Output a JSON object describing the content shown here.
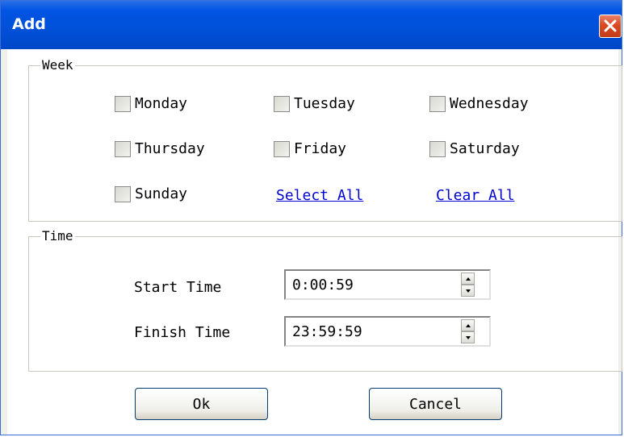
{
  "window": {
    "title": "Add"
  },
  "week": {
    "legend": "Week",
    "days": [
      {
        "label": "Monday",
        "checked": false
      },
      {
        "label": "Tuesday",
        "checked": false
      },
      {
        "label": "Wednesday",
        "checked": false
      },
      {
        "label": "Thursday",
        "checked": false
      },
      {
        "label": "Friday",
        "checked": false
      },
      {
        "label": "Saturday",
        "checked": false
      },
      {
        "label": "Sunday",
        "checked": false
      }
    ],
    "select_all": "Select All",
    "clear_all": "Clear All"
  },
  "time": {
    "legend": "Time",
    "start_label": "Start Time",
    "start_value": "0:00:59",
    "finish_label": "Finish Time",
    "finish_value": "23:59:59"
  },
  "buttons": {
    "ok": "Ok",
    "cancel": "Cancel"
  },
  "colors": {
    "titlebar": "#0054e3",
    "close": "#d94a24",
    "link": "#0000d0",
    "client_bg": "#ffffff"
  },
  "icons": {
    "close": "close-x-icon",
    "spin_up": "arrow-up-icon",
    "spin_down": "arrow-down-icon"
  }
}
